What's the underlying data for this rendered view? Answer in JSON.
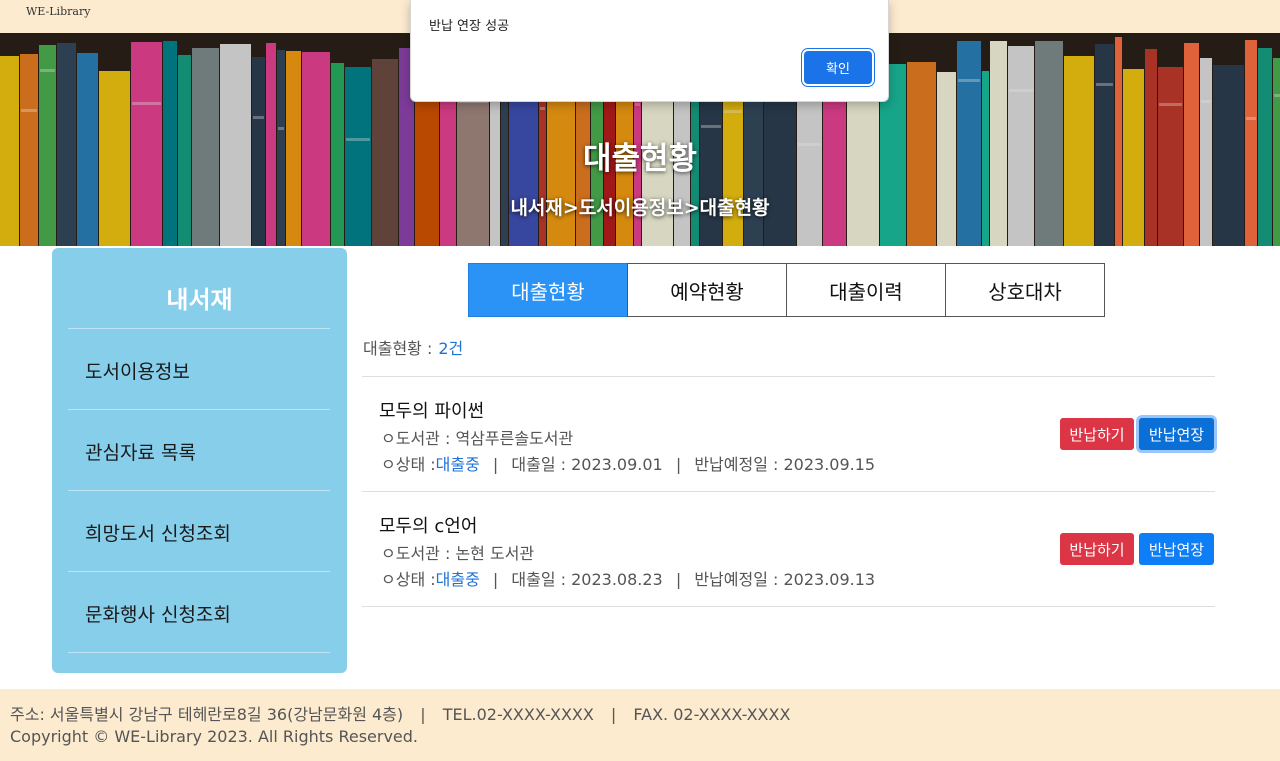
{
  "header": {
    "logo": "WE-Library"
  },
  "hero": {
    "title": "대출현황",
    "breadcrumb": "내서재>도서이용정보>대출현황"
  },
  "sidebar": {
    "title": "내서재",
    "items": [
      {
        "label": "도서이용정보"
      },
      {
        "label": "관심자료 목록"
      },
      {
        "label": "희망도서 신청조회"
      },
      {
        "label": "문화행사 신청조회"
      }
    ]
  },
  "tabs": [
    {
      "label": "대출현황",
      "active": true
    },
    {
      "label": "예약현황",
      "active": false
    },
    {
      "label": "대출이력",
      "active": false
    },
    {
      "label": "상호대차",
      "active": false
    }
  ],
  "summary": {
    "label": "대출현황 :",
    "count": "2건"
  },
  "loans": [
    {
      "title": "모두의 파이썬",
      "library": "ㅇ도서관 : 역삼푸른솔도서관",
      "status_label": "ㅇ상태 :",
      "status": "대출중",
      "loan_date": "대출일 : 2023.09.01",
      "due_date": "반납예정일 : 2023.09.15",
      "return_label": "반납하기",
      "extend_label": "반납연장"
    },
    {
      "title": "모두의 c언어",
      "library": "ㅇ도서관 : 논현 도서관",
      "status_label": "ㅇ상태 :",
      "status": "대출중",
      "loan_date": "대출일 : 2023.08.23",
      "due_date": "반납예정일 : 2023.09.13",
      "return_label": "반납하기",
      "extend_label": "반납연장"
    }
  ],
  "footer": {
    "address": "주소: 서울특별시 강남구 테헤란로8길 36(강남문화원 4층)",
    "tel": "TEL.02-XXXX-XXXX",
    "fax": "FAX. 02-XXXX-XXXX",
    "copyright": "Copyright © WE-Library 2023. All Rights Reserved."
  },
  "dialog": {
    "message": "반납 연장 성공",
    "ok_label": "확인"
  },
  "colors": {
    "topbar": "#fdebd0",
    "sidebar": "#87ceeb",
    "tab_active": "#2a93f5",
    "return_button": "#dc3545",
    "extend_button": "#0d7ef5",
    "status_link": "#1f72d6",
    "dialog_button": "#1a73e8"
  }
}
